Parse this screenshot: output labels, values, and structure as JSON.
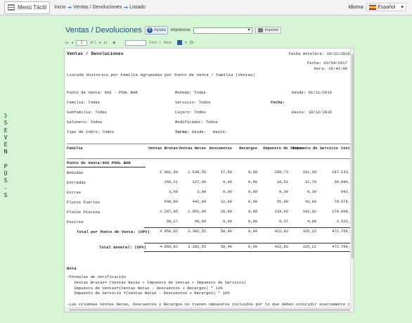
{
  "topbar": {
    "menu_label": "Menú Táctil",
    "crumbs": [
      "Inicio",
      "Ventas / Devoluciones",
      "Listado"
    ],
    "idioma_label": "Idioma:",
    "language": "Español"
  },
  "sidebar_letters": [
    "S",
    "E",
    "V",
    "E",
    "N",
    "",
    "P",
    "O",
    "S",
    "-",
    "S"
  ],
  "page": {
    "title": "Ventas / Devoluciones",
    "help": "Ayuda",
    "printer_label": "Impresora:",
    "print_button": "Imprimir"
  },
  "viewer": {
    "page_current": "1",
    "page_of": "of 1",
    "find": "Find",
    "next": "Next"
  },
  "report": {
    "title": "Ventas / Devoluciones",
    "fecha_hotelera": "Fecha Hotelera: 19/12/2016",
    "fecha": "Fecha: 03/04/2017",
    "hora": "Hora: 10:42:08",
    "subtitle": "Listado Historico por Familia Agrupadas por Punto de Venta / Familia  (Ventas)",
    "filters": {
      "punto_venta": "Punto de Venta: 002 - POOL BAR",
      "familia": "Familia: Todas",
      "subfamilia": "Subfamilia: Todas",
      "salonero": "Salonero: Todos",
      "tipo_cobro": "Tipo de Cobro: Todos",
      "moneda": "Moneda: Todas",
      "servicio": "Servicio: Todos",
      "cajero": "Cajero: Todos",
      "modificador": "Modificador: Todos",
      "turno": "Turno:",
      "desde_turno": "Desde:",
      "hasta_turno": "Hasta:",
      "fecha_label": "Fecha:",
      "desde": "Desde: 01/11/2016",
      "hasta": "Hasta: 18/12/2016"
    },
    "columns": [
      "Familia",
      "Ventas Brutas",
      "Ventas Netas",
      "Descuentos",
      "Recargos",
      "Impuesto de Ventas",
      "Impuesto de Servicio",
      "Cost"
    ],
    "group_label": "Punto de Venta:002  POOL BAR",
    "rows": [
      {
        "name": "Bebidas",
        "vals": [
          "2.001,80",
          "1.630,55",
          "17,60",
          "0,00",
          "209,73",
          "161,30",
          "187.133,"
        ]
      },
      {
        "name": "Entradas",
        "vals": [
          "156,21",
          "127,00",
          "0,00",
          "0,00",
          "16,51",
          "12,70",
          "36.084,"
        ]
      },
      {
        "name": "Extras",
        "vals": [
          "3,69",
          "3,00",
          "0,00",
          "0,00",
          "0,39",
          "0,30",
          "842,"
        ]
      },
      {
        "name": "Platos Fuertes",
        "vals": [
          "540,90",
          "442,00",
          "12,00",
          "0,00",
          "55,90",
          "43,00",
          "70.578,"
        ]
      },
      {
        "name": "Platos Piscina",
        "vals": [
          "1.287,95",
          "1.051,00",
          "20,80",
          "0,00",
          "133,93",
          "103,02",
          "174.608,"
        ]
      },
      {
        "name": "Postres",
        "vals": [
          "60,27",
          "49,00",
          "0,00",
          "0,00",
          "6,37",
          "4,90",
          "3.522,"
        ]
      }
    ],
    "total_pv": {
      "name": "Total por Punto de Venta: (UPV)",
      "vals": [
        "4.050,82",
        "3.302,55",
        "50,40",
        "0,00",
        "422,83",
        "325,22",
        "472.769,"
      ]
    },
    "total_general": {
      "name": "Total General: (UPV)",
      "vals": [
        "4.050,82",
        "3.302,55",
        "50,40",
        "0,00",
        "422,83",
        "325,22",
        "472.769,"
      ]
    },
    "nota_title": "Nota",
    "nota_lines": [
      "-Fórmulas de Verificación",
      "   Ventas Brutas= (Ventas Netas + Impuesto de Ventas + Impuesto de Servicio)",
      "   Impuesto de Ventas=(Ventas Netas - Descuentos + Recargos) * 13%",
      "   Impuesto de Servicio =(Ventas Netas - Descuentos + Recargos) * 10%",
      "",
      "-Las columnas Ventas Netas, Descuentos y Recargos no tienen impuestos incluidos por lo que deben coincidir exactamente con los apuntes",
      "de dichos conceptos en los asientos contables de Puntos de Venta generados en la auditoria nocturna y con el reporte de Resumen de",
      "Transacciones del Modulo de FrontDesk generado durante la auditoria."
    ]
  }
}
